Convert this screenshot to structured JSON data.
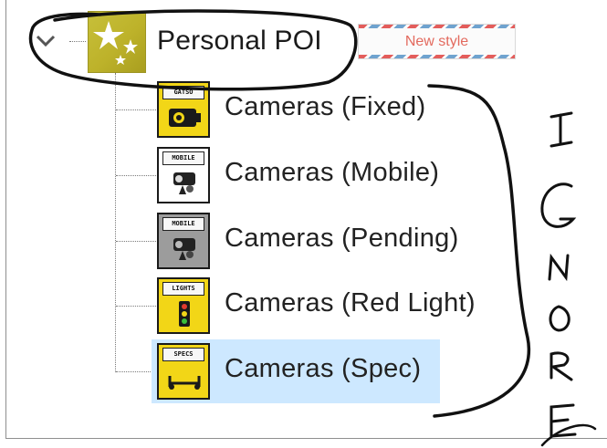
{
  "tree": {
    "root": {
      "label": "Personal POI",
      "icon": "stars-folder-icon",
      "expanded": true
    },
    "items": [
      {
        "label": "Cameras (Fixed)",
        "icon": "gatso-camera-icon",
        "icon_tag": "GATSO",
        "selected": false
      },
      {
        "label": "Cameras (Mobile)",
        "icon": "mobile-camera-icon",
        "icon_tag": "MOBILE",
        "selected": false
      },
      {
        "label": "Cameras (Pending)",
        "icon": "mobile-camera-pending-icon",
        "icon_tag": "MOBILE",
        "selected": false
      },
      {
        "label": "Cameras (Red Light)",
        "icon": "traffic-light-camera-icon",
        "icon_tag": "LIGHTS",
        "selected": false
      },
      {
        "label": "Cameras (Spec)",
        "icon": "spec-camera-icon",
        "icon_tag": "SPECS",
        "selected": true
      }
    ]
  },
  "new_style_button": {
    "label": "New style"
  },
  "annotation": {
    "text": "IGNORE"
  },
  "colors": {
    "selection": "#cde8ff",
    "icon_yellow": "#f2d617",
    "folder_olive": "#c2ba33",
    "button_text": "#e36a5e"
  }
}
